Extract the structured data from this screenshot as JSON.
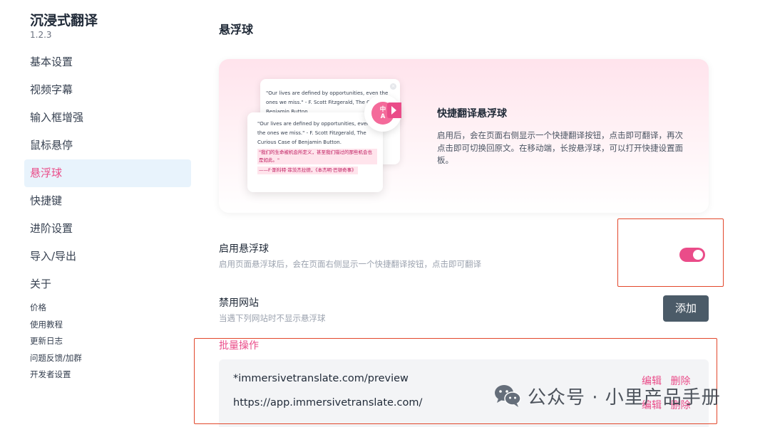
{
  "app": {
    "name": "沉浸式翻译",
    "version": "1.2.3"
  },
  "sidebar": {
    "items": [
      {
        "label": "基本设置"
      },
      {
        "label": "视频字幕"
      },
      {
        "label": "输入框增强"
      },
      {
        "label": "鼠标悬停"
      },
      {
        "label": "悬浮球",
        "active": true
      },
      {
        "label": "快捷键"
      },
      {
        "label": "进阶设置"
      },
      {
        "label": "导入/导出"
      },
      {
        "label": "关于"
      }
    ],
    "sub_items": [
      {
        "label": "价格"
      },
      {
        "label": "使用教程"
      },
      {
        "label": "更新日志"
      },
      {
        "label": "问题反馈/加群"
      },
      {
        "label": "开发者设置"
      }
    ]
  },
  "page": {
    "title": "悬浮球"
  },
  "hero": {
    "title": "快捷翻译悬浮球",
    "desc": "启用后，会在页面右侧显示一个快捷翻译按钮，点击即可翻译，再次点击即可切换回原文。在移动端，长按悬浮球，可以打开快捷设置面板。",
    "preview_back_text": "\"Our lives are defined by opportunities, even the ones we miss.\" - F. Scott Fitzgerald, The Case of Benjamin Button",
    "preview_front_en": "\"Our lives are defined by opportunities, even the ones we miss.\" - F. Scott Fitzgerald, The Curious Case of Benjamin Button.",
    "preview_front_cn1": "\"我们的生命被机会所定义，甚至我们错过的那些机会也是如此。\"",
    "preview_front_cn2": "——F·斯科特·菲茨杰拉德，《本杰明·巴顿奇事》",
    "ball_label": "中\nA"
  },
  "settings": {
    "enable_ball": {
      "title": "启用悬浮球",
      "desc": "启用页面悬浮球后，会在页面右侧显示一个快捷翻译按钮，点击即可翻译",
      "enabled": true
    },
    "blocked_sites": {
      "title": "禁用网站",
      "desc": "当遇下列网站时不显示悬浮球",
      "add_label": "添加",
      "batch_label": "批量操作",
      "sites": [
        {
          "url": "*immersivetranslate.com/preview",
          "edit": "编辑",
          "delete": "删除"
        },
        {
          "url": "https://app.immersivetranslate.com/",
          "edit": "编辑",
          "delete": "删除"
        }
      ]
    }
  },
  "watermark": {
    "text": "公众号 · 小里产品手册"
  },
  "colors": {
    "accent": "#ea4c89",
    "active_bg": "#e8f3fc",
    "button_dark": "#4b5b68",
    "annotation": "#e2472b"
  }
}
